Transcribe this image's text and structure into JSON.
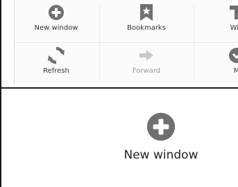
{
  "menu": {
    "items": [
      {
        "label": "New window",
        "icon": "plus-circle-icon",
        "enabled": true
      },
      {
        "label": "Bookmarks",
        "icon": "bookmark-star-icon",
        "enabled": true
      },
      {
        "label": "Win",
        "icon": "windows-icon",
        "enabled": true
      },
      {
        "label": "Refresh",
        "icon": "refresh-icon",
        "enabled": true
      },
      {
        "label": "Forward",
        "icon": "forward-arrow-icon",
        "enabled": false
      },
      {
        "label": "M",
        "icon": "more-icon",
        "enabled": true
      }
    ]
  },
  "preview": {
    "label": "New window",
    "icon": "plus-circle-icon"
  },
  "colors": {
    "icon_gray": "#6f6f6f",
    "icon_disabled": "#c8c8c8",
    "border": "#1a1a1a"
  }
}
